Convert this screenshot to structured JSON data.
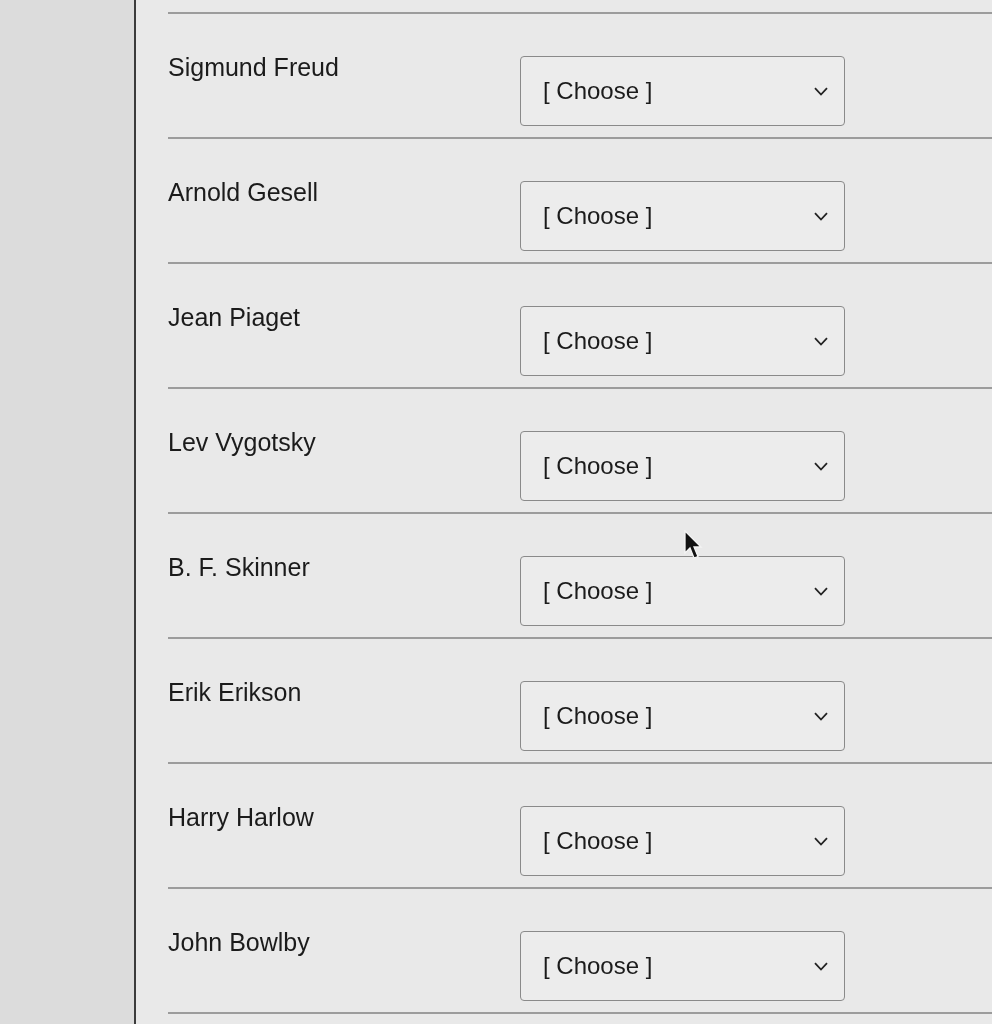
{
  "questions": [
    {
      "term": "Sigmund Freud",
      "selection": "[ Choose ]"
    },
    {
      "term": "Arnold Gesell",
      "selection": "[ Choose ]"
    },
    {
      "term": "Jean Piaget",
      "selection": "[ Choose ]"
    },
    {
      "term": "Lev Vygotsky",
      "selection": "[ Choose ]"
    },
    {
      "term": "B. F. Skinner",
      "selection": "[ Choose ]"
    },
    {
      "term": "Erik Erikson",
      "selection": "[ Choose ]"
    },
    {
      "term": "Harry Harlow",
      "selection": "[ Choose ]"
    },
    {
      "term": "John Bowlby",
      "selection": "[ Choose ]"
    }
  ]
}
